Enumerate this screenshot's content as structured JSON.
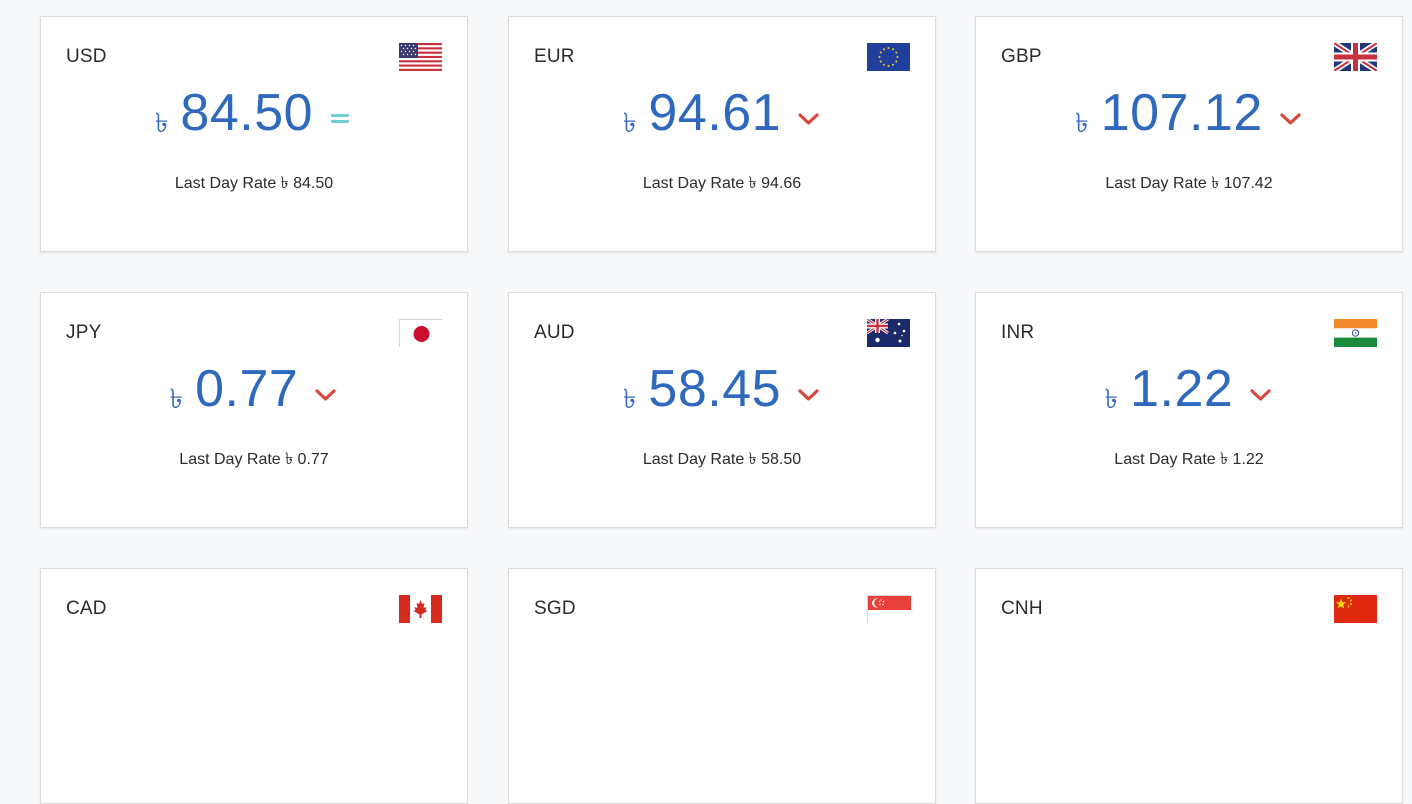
{
  "currency_symbol": "৳",
  "colors": {
    "value_blue": "#2f69be",
    "down_red": "#d9463e",
    "equal_teal": "#6fd0cf"
  },
  "cards": [
    {
      "code": "USD",
      "flag_icon": "us-flag-icon",
      "rate": "84.50",
      "trend": "equal",
      "last_day_label": "Last Day Rate ৳ 84.50"
    },
    {
      "code": "EUR",
      "flag_icon": "eu-flag-icon",
      "rate": "94.61",
      "trend": "down",
      "last_day_label": "Last Day Rate ৳ 94.66"
    },
    {
      "code": "GBP",
      "flag_icon": "uk-flag-icon",
      "rate": "107.12",
      "trend": "down",
      "last_day_label": "Last Day Rate ৳ 107.42"
    },
    {
      "code": "JPY",
      "flag_icon": "japan-flag-icon",
      "rate": "0.77",
      "trend": "down",
      "last_day_label": "Last Day Rate ৳ 0.77"
    },
    {
      "code": "AUD",
      "flag_icon": "australia-flag-icon",
      "rate": "58.45",
      "trend": "down",
      "last_day_label": "Last Day Rate ৳ 58.50"
    },
    {
      "code": "INR",
      "flag_icon": "india-flag-icon",
      "rate": "1.22",
      "trend": "down",
      "last_day_label": "Last Day Rate ৳ 1.22"
    },
    {
      "code": "CAD",
      "flag_icon": "canada-flag-icon"
    },
    {
      "code": "SGD",
      "flag_icon": "singapore-flag-icon"
    },
    {
      "code": "CNH",
      "flag_icon": "china-flag-icon"
    }
  ]
}
